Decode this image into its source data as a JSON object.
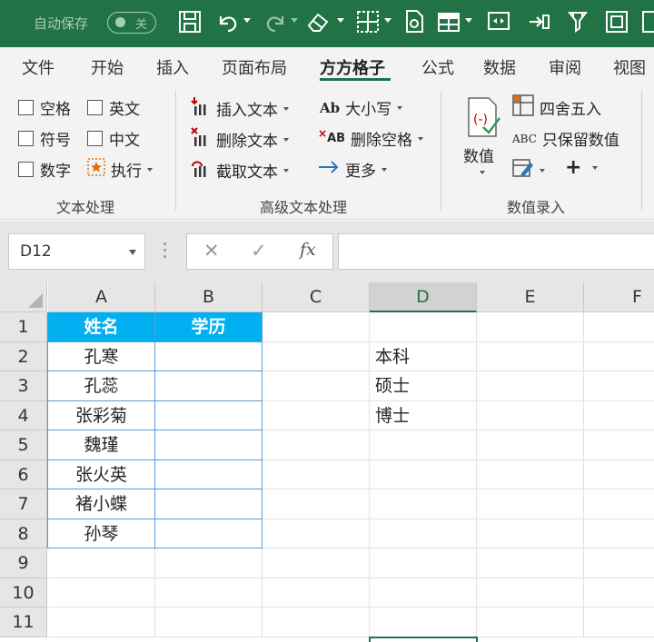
{
  "titlebar": {
    "autosave_label": "自动保存",
    "autosave_state": "关"
  },
  "tabs": [
    "文件",
    "开始",
    "插入",
    "页面布局",
    "方方格子",
    "公式",
    "数据",
    "审阅",
    "视图"
  ],
  "active_tab": "方方格子",
  "ribbon": {
    "text_group": {
      "label": "文本处理",
      "checkboxes": [
        "空格",
        "英文",
        "符号",
        "中文",
        "数字"
      ],
      "execute": "执行"
    },
    "advanced_group": {
      "label": "高级文本处理",
      "insert_text": "插入文本",
      "delete_text": "删除文本",
      "extract_text": "截取文本",
      "case_icon_text": "Ab",
      "case": "大小写",
      "delete_space_icon_text": "AB",
      "delete_space": "删除空格",
      "more": "更多"
    },
    "number_group": {
      "label": "数值录入",
      "value": "数值",
      "round": "四舍五入",
      "keep_value_icon_text": "ABC",
      "keep_value": "只保留数值",
      "add": "+"
    }
  },
  "formula_bar": {
    "name_box": "D12",
    "cancel": "✕",
    "confirm": "✓",
    "fx": "fx",
    "value": ""
  },
  "sheet": {
    "columns": [
      "A",
      "B",
      "C",
      "D",
      "E",
      "F"
    ],
    "rows": [
      "1",
      "2",
      "3",
      "4",
      "5",
      "6",
      "7",
      "8",
      "9",
      "10",
      "11"
    ],
    "selected_column": "D",
    "cells": {
      "A1": "姓名",
      "B1": "学历",
      "A2": "孔寒",
      "A3": "孔蕊",
      "A4": "张彩菊",
      "A5": "魏瑾",
      "A6": "张火英",
      "A7": "褚小蝶",
      "A8": "孙琴",
      "D2": "本科",
      "D3": "硕士",
      "D4": "博士"
    }
  },
  "colors": {
    "excel_green": "#217346",
    "table_header": "#00b0f0",
    "table_border": "#5b9bd5"
  }
}
